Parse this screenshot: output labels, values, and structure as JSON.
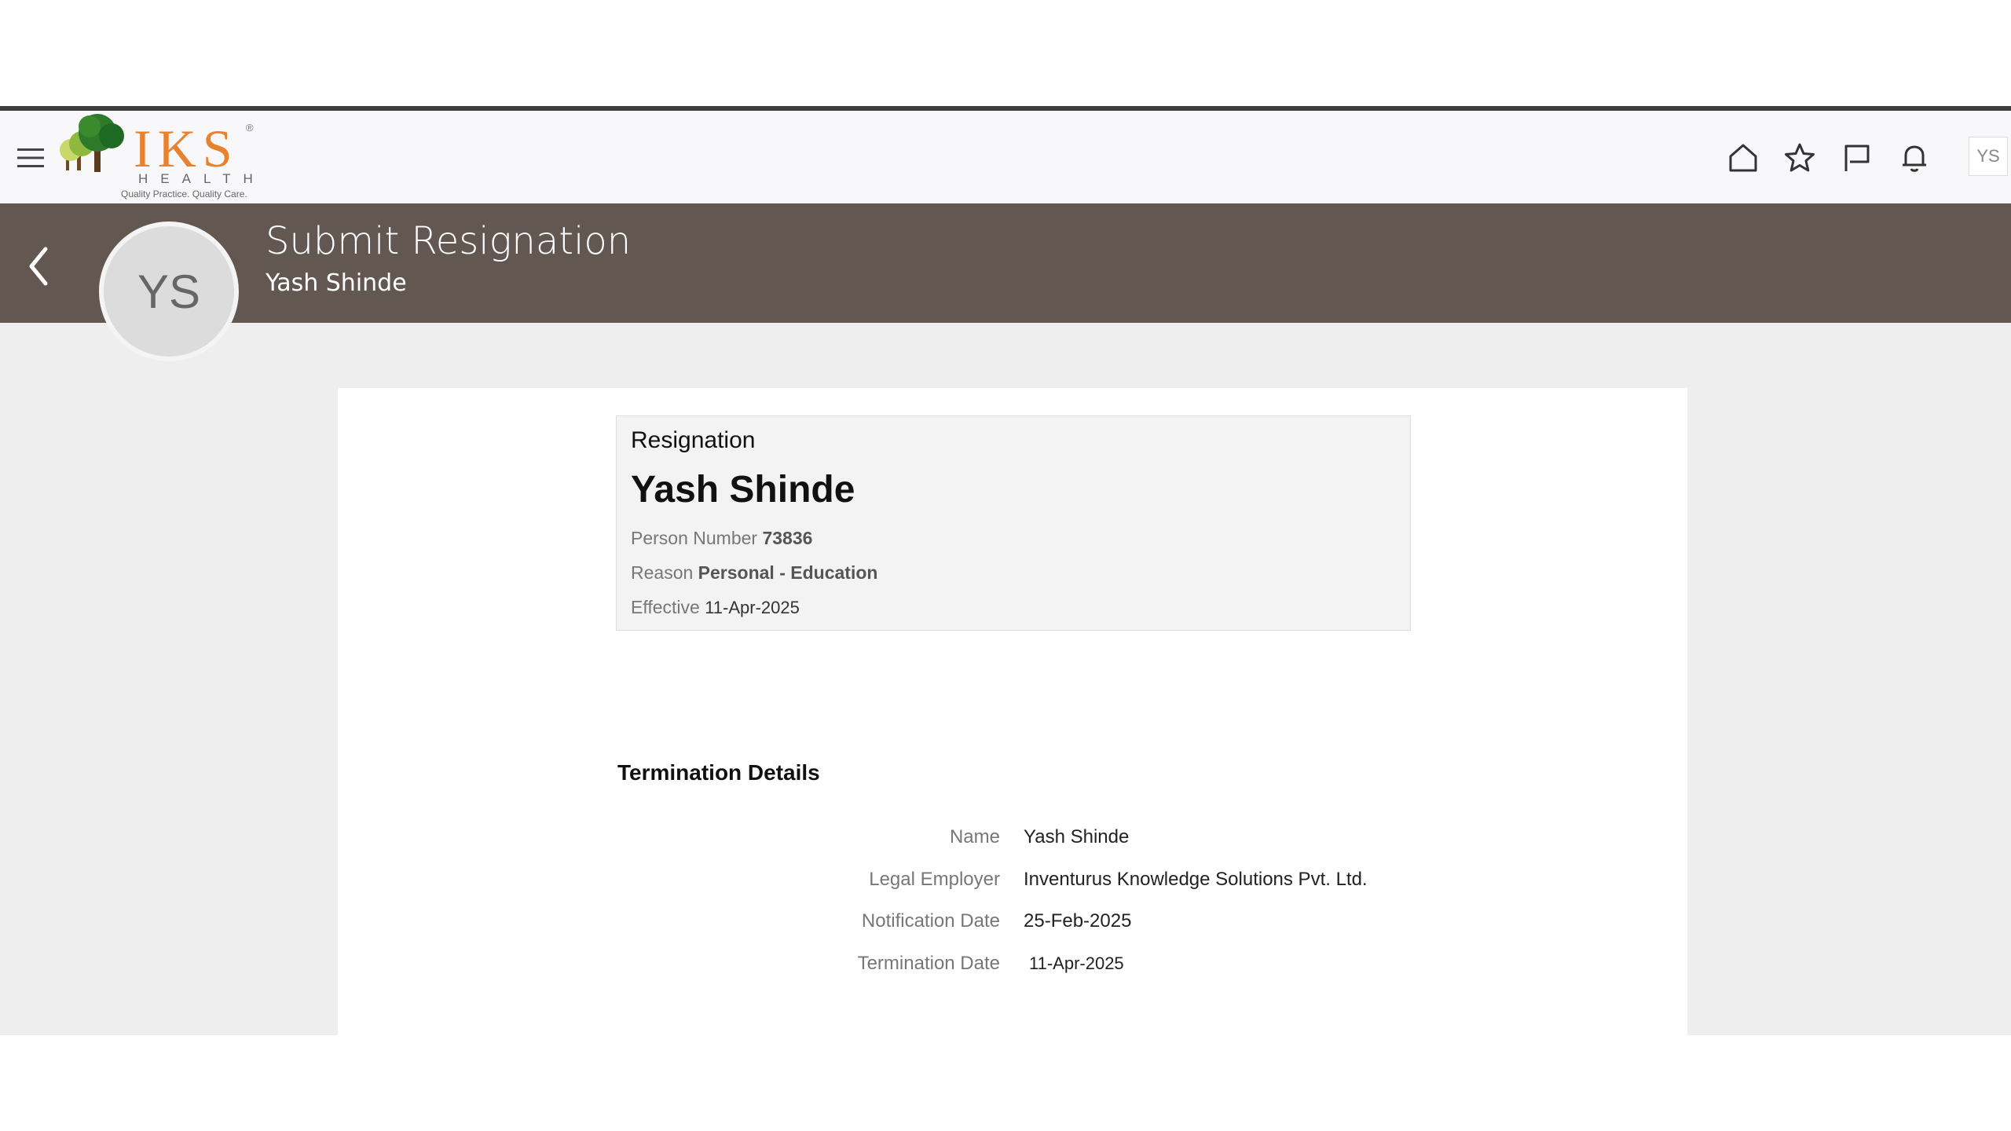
{
  "header": {
    "logo": {
      "wordmark": "IKS",
      "registered": "®",
      "sub": "HEALTH",
      "tagline": "Quality Practice. Quality Care."
    },
    "user_initials": "YS",
    "icons": [
      "home-icon",
      "star-icon",
      "flag-icon",
      "bell-icon"
    ]
  },
  "banner": {
    "title": "Submit Resignation",
    "subtitle": "Yash Shinde",
    "avatar_initials": "YS"
  },
  "summary": {
    "label": "Resignation",
    "name": "Yash Shinde",
    "person_number_label": "Person Number",
    "person_number": "73836",
    "reason_label": "Reason",
    "reason": "Personal - Education",
    "effective_label": "Effective",
    "effective": "11-Apr-2025"
  },
  "termination": {
    "title": "Termination Details",
    "rows": [
      {
        "label": "Name",
        "value": "Yash Shinde"
      },
      {
        "label": "Legal Employer",
        "value": "Inventurus Knowledge Solutions Pvt. Ltd."
      },
      {
        "label": "Notification Date",
        "value": "25-Feb-2025"
      },
      {
        "label": "Termination Date",
        "value": "11-Apr-2025"
      }
    ]
  },
  "colors": {
    "banner": "#635851",
    "page_bg": "#eeeeee",
    "logo_orange": "#e9822e",
    "logo_green": "#3f8a2e"
  }
}
